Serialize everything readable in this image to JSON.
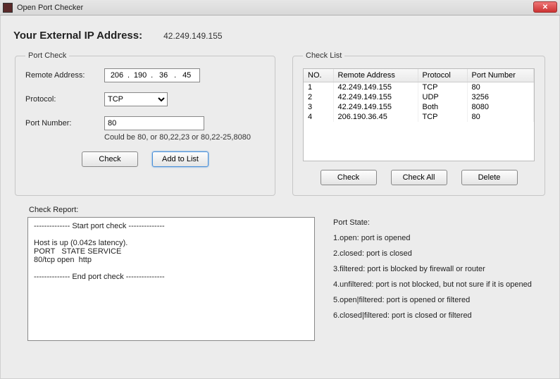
{
  "window": {
    "title": "Open Port Checker",
    "close_icon": "✕"
  },
  "ip": {
    "label": "Your External IP Address:",
    "value": "42.249.149.155"
  },
  "portcheck": {
    "legend": "Port Check",
    "remote_label": "Remote Address:",
    "remote_octets": [
      "206",
      "190",
      "36",
      "45"
    ],
    "protocol_label": "Protocol:",
    "protocol_value": "TCP",
    "portnum_label": "Port Number:",
    "portnum_value": "80",
    "hint": "Could be 80, or 80,22,23 or 80,22-25,8080",
    "check_btn": "Check",
    "add_btn": "Add to List"
  },
  "checklist": {
    "legend": "Check List",
    "headers": {
      "no": "NO.",
      "addr": "Remote Address",
      "proto": "Protocol",
      "port": "Port Number"
    },
    "rows": [
      {
        "no": "1",
        "addr": "42.249.149.155",
        "proto": "TCP",
        "port": "80"
      },
      {
        "no": "2",
        "addr": "42.249.149.155",
        "proto": "UDP",
        "port": "3256"
      },
      {
        "no": "3",
        "addr": "42.249.149.155",
        "proto": "Both",
        "port": "8080"
      },
      {
        "no": "4",
        "addr": "206.190.36.45",
        "proto": "TCP",
        "port": "80"
      }
    ],
    "check_btn": "Check",
    "checkall_btn": "Check All",
    "delete_btn": "Delete"
  },
  "report": {
    "label": "Check Report:",
    "text": "-------------- Start port check --------------\n\nHost is up (0.042s latency).\nPORT   STATE SERVICE\n80/tcp open  http\n\n-------------- End port check ---------------"
  },
  "states": {
    "label": "Port State:",
    "lines": [
      "1.open: port is opened",
      "2.closed: port is closed",
      "3.filtered: port is blocked by firewall or router",
      "4.unfiltered: port is not blocked, but not sure if it is opened",
      "5.open|filtered: port is opened or filtered",
      "6.closed|filtered: port is closed or filtered"
    ]
  }
}
